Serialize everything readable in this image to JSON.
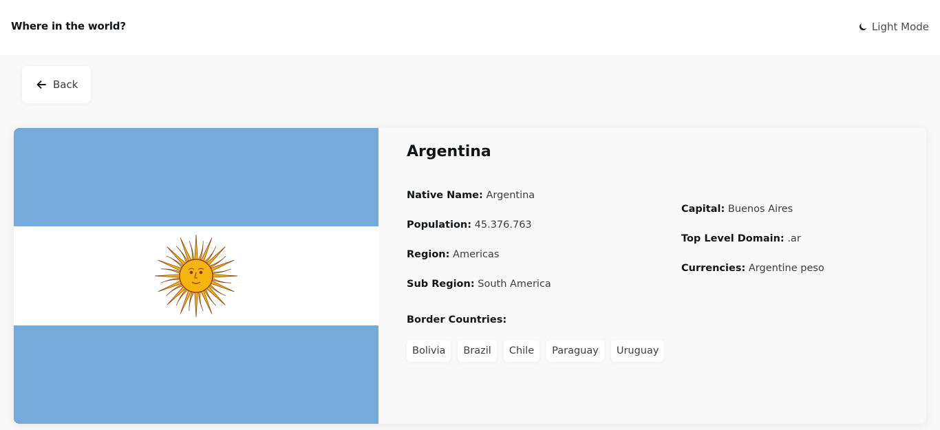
{
  "header": {
    "title": "Where in the world?",
    "mode_label": "Light Mode",
    "mode_icon": "moon-icon"
  },
  "back": {
    "label": "Back",
    "icon": "arrow-left-icon"
  },
  "country": {
    "name": "Argentina",
    "flag": {
      "icon": "argentina-flag",
      "colors": {
        "sky_blue": "#75AADB",
        "white": "#FFFFFF",
        "sun": "#F6B40E",
        "sun_outline": "#85340A"
      }
    },
    "left_info": [
      {
        "key": "Native Name:",
        "value": "Argentina"
      },
      {
        "key": "Population:",
        "value": "45.376.763"
      },
      {
        "key": "Region:",
        "value": "Americas"
      },
      {
        "key": "Sub Region:",
        "value": "South America"
      }
    ],
    "right_info": [
      {
        "key": "Capital:",
        "value": "Buenos Aires"
      },
      {
        "key": "Top Level Domain:",
        "value": ".ar"
      },
      {
        "key": "Currencies:",
        "value": "Argentine peso"
      }
    ],
    "border_label": "Border Countries:",
    "borders": [
      "Bolivia",
      "Brazil",
      "Chile",
      "Paraguay",
      "Uruguay"
    ]
  }
}
